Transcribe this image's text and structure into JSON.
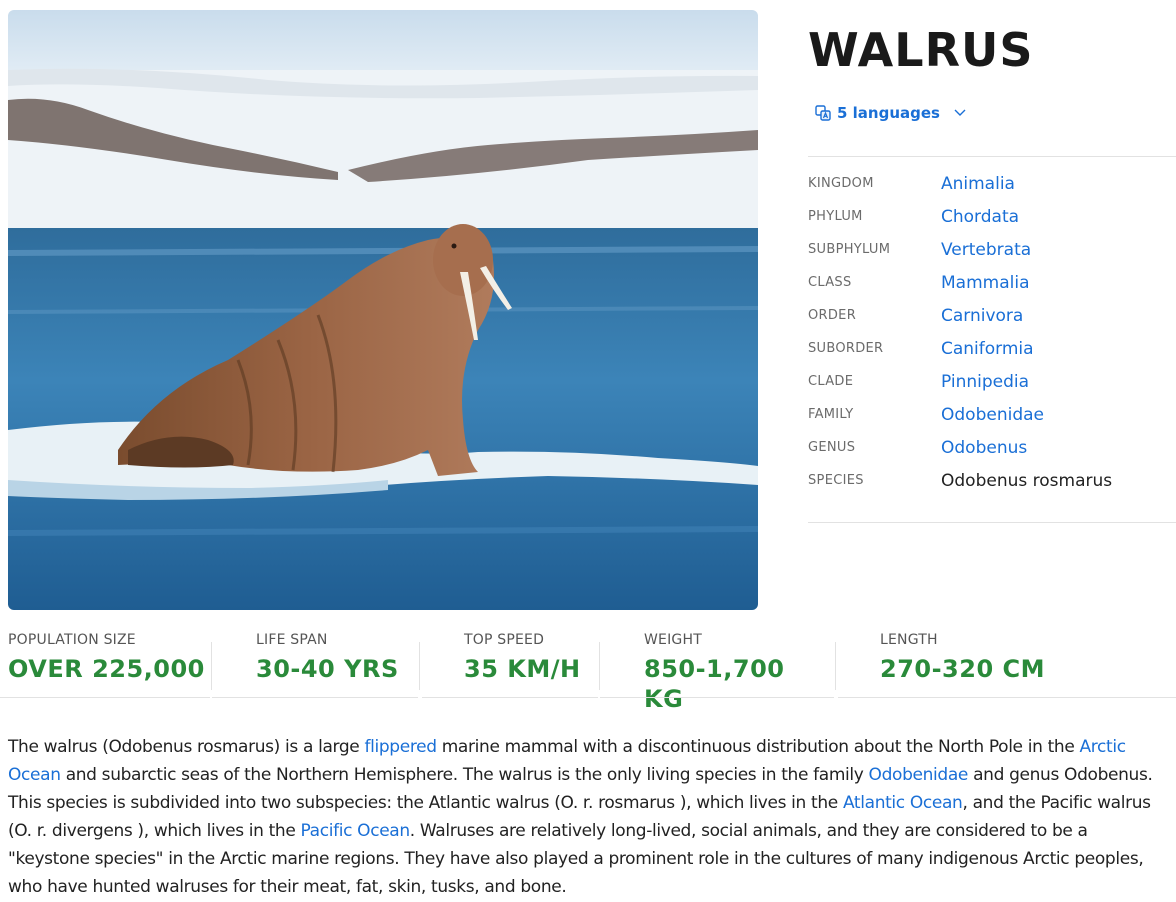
{
  "hero": {
    "image_alt": "walrus",
    "icon": "walrus-photo"
  },
  "title": "WALRUS",
  "languages": {
    "label": "5 languages",
    "icon": "translate-icon",
    "chevron": "chevron-down-icon"
  },
  "taxonomy": [
    {
      "label": "KINGDOM",
      "value": "Animalia",
      "link": true
    },
    {
      "label": "PHYLUM",
      "value": "Chordata",
      "link": true
    },
    {
      "label": "SUBPHYLUM",
      "value": "Vertebrata",
      "link": true
    },
    {
      "label": "CLASS",
      "value": "Mammalia",
      "link": true
    },
    {
      "label": "ORDER",
      "value": "Carnivora",
      "link": true
    },
    {
      "label": "SUBORDER",
      "value": "Caniformia",
      "link": true
    },
    {
      "label": "CLADE",
      "value": "Pinnipedia",
      "link": true
    },
    {
      "label": "FAMILY",
      "value": "Odobenidae",
      "link": true
    },
    {
      "label": "GENUS",
      "value": "Odobenus",
      "link": true
    },
    {
      "label": "SPECIES",
      "value": "Odobenus rosmarus",
      "link": false
    }
  ],
  "stats": [
    {
      "label": "POPULATION SIZE",
      "value": "OVER 225,000"
    },
    {
      "label": "LIFE SPAN",
      "value": "30-40 YRS"
    },
    {
      "label": "TOP SPEED",
      "value": "35 KM/H"
    },
    {
      "label": "WEIGHT",
      "value": "850-1,700 KG"
    },
    {
      "label": "LENGTH",
      "value": "270-320 CM"
    }
  ],
  "description": {
    "t1": "The walrus (Odobenus rosmarus) is a large ",
    "l1": "flippered",
    "t2": " marine mammal with a discontinuous distribution about the North Pole in the ",
    "l2": "Arctic Ocean",
    "t3": " and subarctic seas of the Northern Hemisphere. The walrus is the only living species in the family ",
    "l3": "Odobenidae",
    "t4": " and genus Odobenus. This species is subdivided into two subspecies: the Atlantic walrus (O. r. rosmarus ), which lives in the ",
    "l4": "Atlantic Ocean",
    "t5": ", and the Pacific walrus (O. r. divergens ), which lives in the ",
    "l5": "Pacific Ocean",
    "t6": ". Walruses are relatively long-lived, social animals, and they are considered to be a \"keystone species\" in the Arctic marine regions. They have also played a prominent role in the cultures of many indigenous Arctic peoples, who have hunted walruses for their meat, fat, skin, tusks, and bone."
  },
  "colors": {
    "link": "#1a6fd6",
    "stat_value": "#2a8a3a",
    "label_gray": "#6b6b6b"
  }
}
